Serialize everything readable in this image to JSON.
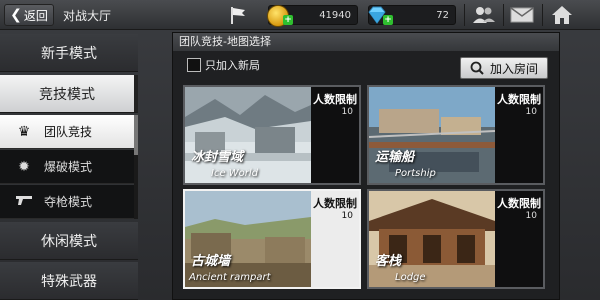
{
  "topbar": {
    "back_label": "返回",
    "title": "对战大厅",
    "coins": "41940",
    "gems": "72",
    "icons": [
      "flag-icon",
      "coin-icon",
      "gem-icon",
      "friends-icon",
      "mail-icon",
      "home-icon"
    ]
  },
  "sidebar": {
    "modes": [
      {
        "label": "新手模式"
      },
      {
        "label": "竞技模式"
      },
      {
        "label": "休闲模式"
      },
      {
        "label": "特殊武器"
      }
    ],
    "submodes": [
      {
        "label": "团队竞技",
        "icon": "crown-icon"
      },
      {
        "label": "爆破模式",
        "icon": "explosion-icon"
      },
      {
        "label": "夺枪模式",
        "icon": "gun-icon"
      }
    ]
  },
  "panel": {
    "header": "团队竞技-地图选择",
    "filter_label": "只加入新局",
    "join_label": "加入房间",
    "maps": [
      {
        "name_cn": "冰封雪域",
        "name_en": "Ice World",
        "limit_label": "人数限制",
        "limit": "10"
      },
      {
        "name_cn": "运输船",
        "name_en": "Portship",
        "limit_label": "人数限制",
        "limit": "10"
      },
      {
        "name_cn": "古城墙",
        "name_en": "Ancient rampart",
        "limit_label": "人数限制",
        "limit": "10"
      },
      {
        "name_cn": "客栈",
        "name_en": "Lodge",
        "limit_label": "人数限制",
        "limit": "10"
      }
    ]
  },
  "colors": {
    "accent_green": "#2fbf2f",
    "coin_gold": "#f2b400",
    "selected_border": "#f2f2f2"
  }
}
